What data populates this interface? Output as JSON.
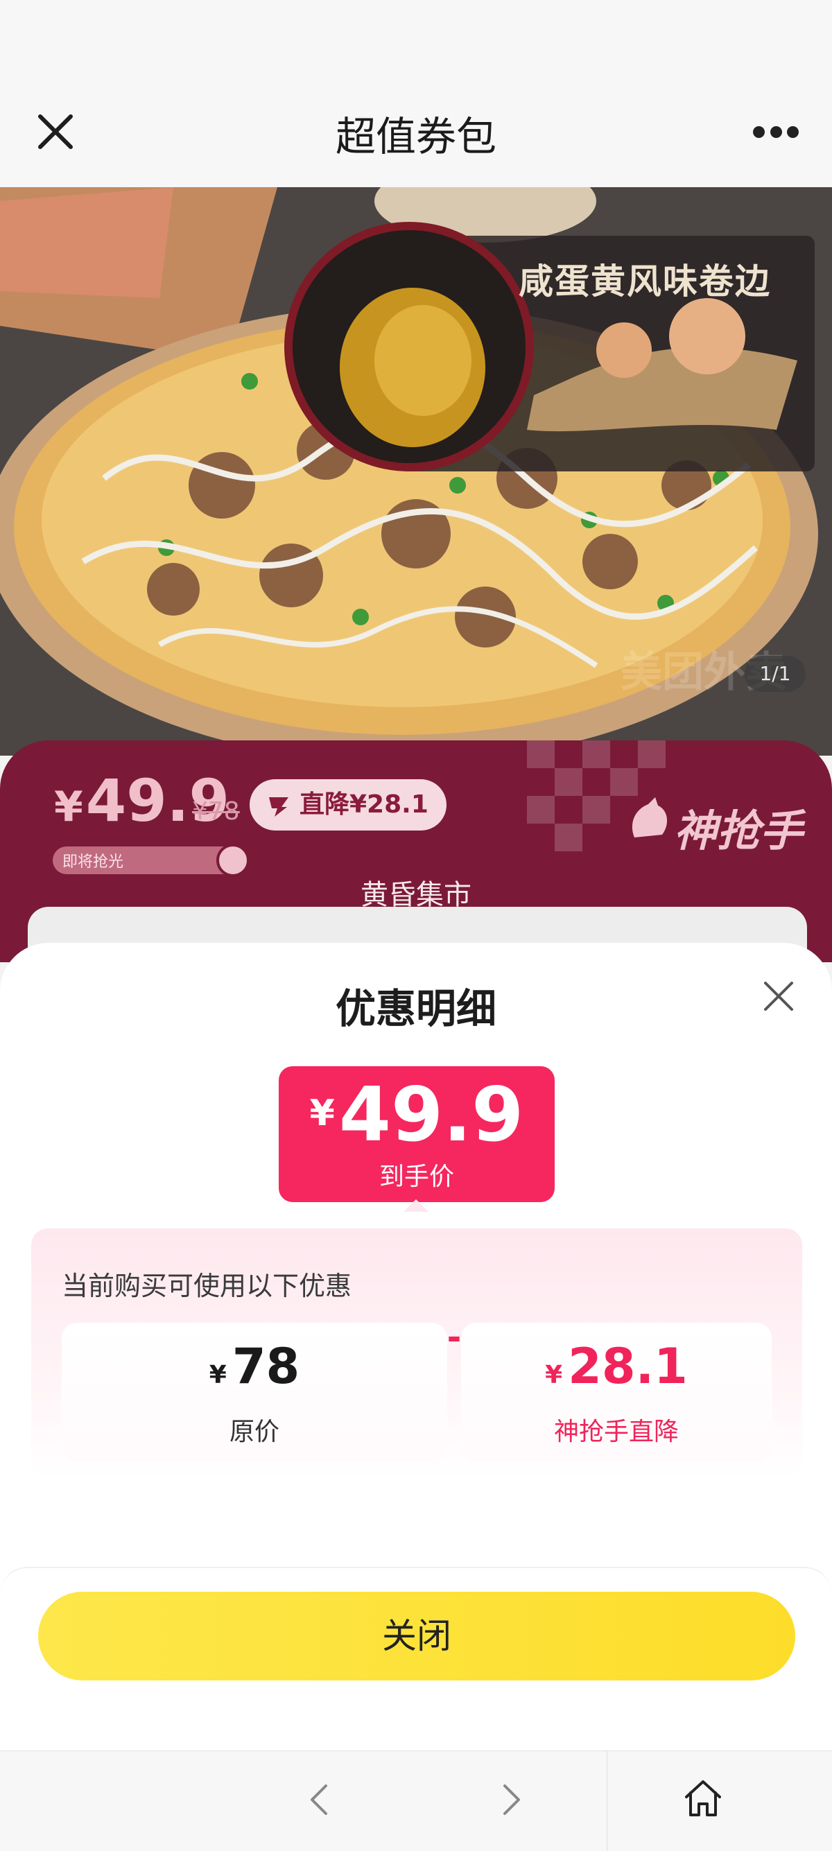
{
  "nav": {
    "title": "超值券包",
    "close_icon": "close-icon",
    "more_icon": "more-icon"
  },
  "hero": {
    "caption": "咸蛋黄风味卷边",
    "page_counter": "1/1"
  },
  "band": {
    "currency": "¥",
    "price": "49.9",
    "original_price": "¥78",
    "discount_badge": "直降¥28.1",
    "brand": "神抢手",
    "stock_label": "即将抢光",
    "subtitle": "黄昏集市"
  },
  "sheet": {
    "title": "优惠明细",
    "final": {
      "currency": "¥",
      "price": "49.9",
      "label": "到手价"
    },
    "deals_title": "当前购买可使用以下优惠",
    "original": {
      "currency": "¥",
      "value": "78",
      "label": "原价"
    },
    "operator": "-",
    "discount": {
      "currency": "¥",
      "value": "28.1",
      "label": "神抢手直降"
    },
    "close_button": "关闭"
  },
  "colors": {
    "accent": "#f5275e",
    "button": "#fde74a",
    "band": "#7a1a38"
  }
}
